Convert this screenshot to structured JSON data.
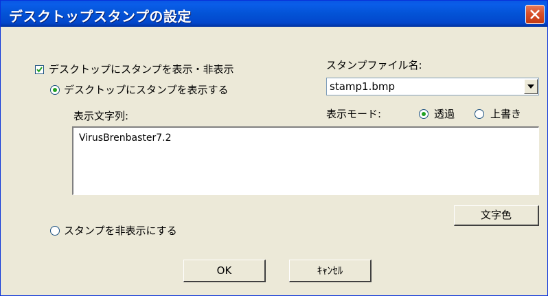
{
  "window": {
    "title": "デスクトップスタンプの設定"
  },
  "show_hide_checkbox": {
    "label": "デスクトップにスタンプを表示・非表示",
    "checked": true
  },
  "show_radio": {
    "label": "デスクトップにスタンプを表示する",
    "selected": true
  },
  "hide_radio": {
    "label": "スタンプを非表示にする",
    "selected": false
  },
  "stamp_file": {
    "label": "スタンプファイル名:",
    "value": "stamp1.bmp"
  },
  "display_text": {
    "label": "表示文字列:",
    "value": "VirusBrenbaster7.2"
  },
  "display_mode": {
    "label": "表示モード:",
    "options": [
      "透過",
      "上書き"
    ],
    "selected": "透過"
  },
  "buttons": {
    "text_color": "文字色",
    "ok": "OK",
    "cancel": "ｷｬﾝｾﾙ"
  },
  "colors": {
    "titlebar": "#0353d6",
    "dialog_bg": "#ece9d8",
    "close_button": "#d8502a",
    "radio_dot": "#21a121"
  }
}
